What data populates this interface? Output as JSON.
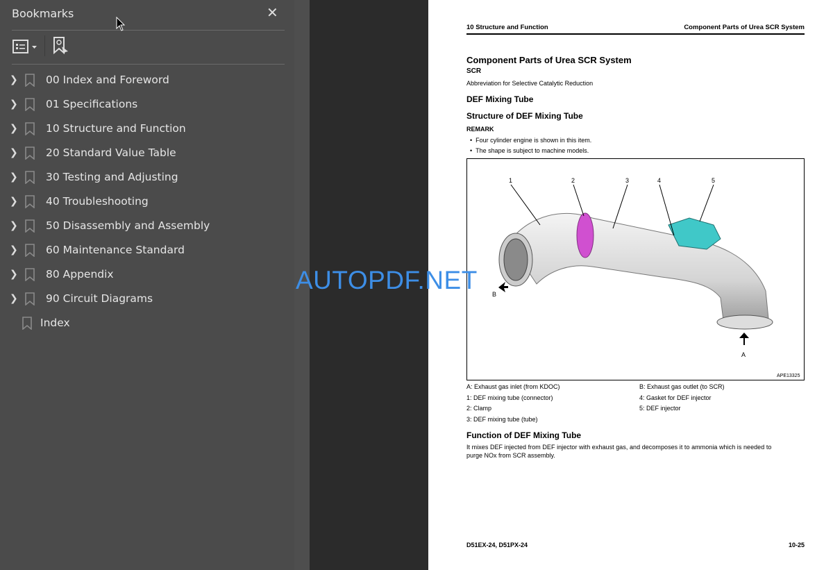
{
  "sidebar": {
    "title": "Bookmarks",
    "close_icon": "close-icon",
    "items": [
      {
        "label": "00 Index and Foreword",
        "expandable": true
      },
      {
        "label": "01 Specifications",
        "expandable": true
      },
      {
        "label": "10 Structure and Function",
        "expandable": true
      },
      {
        "label": "20 Standard Value Table",
        "expandable": true
      },
      {
        "label": "30 Testing and Adjusting",
        "expandable": true
      },
      {
        "label": "40 Troubleshooting",
        "expandable": true
      },
      {
        "label": "50 Disassembly and Assembly",
        "expandable": true
      },
      {
        "label": "60 Maintenance Standard",
        "expandable": true
      },
      {
        "label": "80 Appendix",
        "expandable": true
      },
      {
        "label": "90 Circuit Diagrams",
        "expandable": true
      },
      {
        "label": "Index",
        "expandable": false
      }
    ]
  },
  "watermark": "AUTOPDF.NET",
  "page": {
    "header_left": "10 Structure and Function",
    "header_right": "Component Parts of Urea SCR System",
    "h1": "Component Parts of Urea SCR System",
    "scr": "SCR",
    "scr_desc": "Abbreviation for Selective Catalytic Reduction",
    "h2": "DEF Mixing Tube",
    "h3": "Structure of DEF Mixing Tube",
    "remark": "REMARK",
    "bullets": [
      "Four cylinder engine is shown in this item.",
      "The shape is subject to machine models."
    ],
    "figure": {
      "id": "APE13325",
      "callouts": [
        "1",
        "2",
        "3",
        "4",
        "5",
        "A",
        "B"
      ]
    },
    "legend_left": [
      "A: Exhaust gas inlet (from KDOC)",
      "1: DEF mixing tube (connector)",
      "2: Clamp",
      "3: DEF mixing tube (tube)"
    ],
    "legend_right": [
      "B: Exhaust gas outlet (to SCR)",
      "4: Gasket for DEF injector",
      "5: DEF injector"
    ],
    "h4": "Function of DEF Mixing Tube",
    "function_text": [
      "It mixes DEF injected from DEF injector with exhaust gas, and decomposes it to ammonia which is needed to",
      "purge NOx from SCR assembly."
    ],
    "footer_left": "D51EX-24, D51PX-24",
    "footer_right": "10-25"
  }
}
